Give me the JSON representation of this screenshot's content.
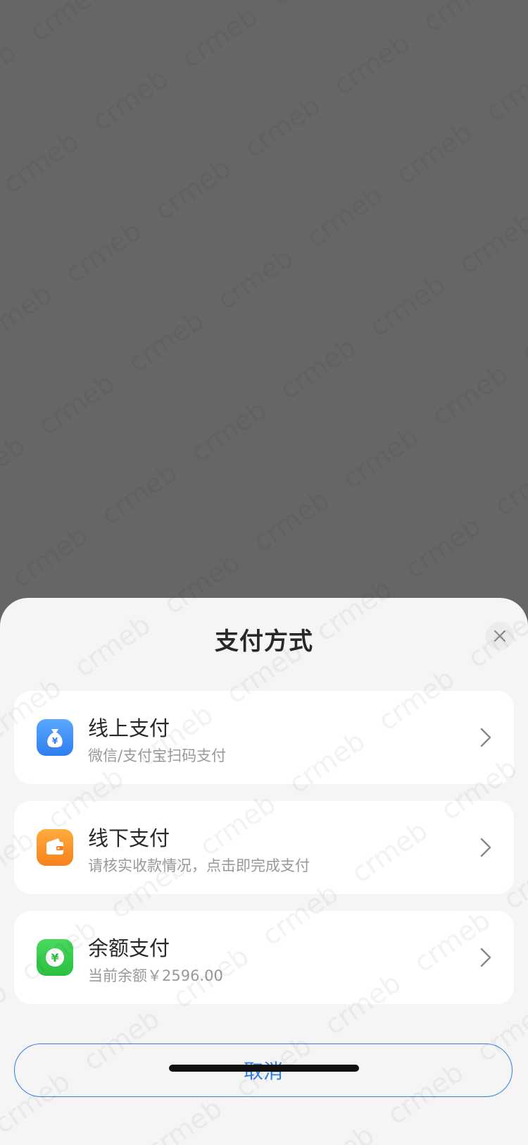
{
  "sheet": {
    "title": "支付方式",
    "close_icon": "close-icon"
  },
  "options": [
    {
      "title": "线上支付",
      "subtitle": "微信/支付宝扫码支付",
      "icon": "money-bag-icon",
      "icon_color": "#3a8df7"
    },
    {
      "title": "线下支付",
      "subtitle": "请核实收款情况，点击即完成支付",
      "icon": "wallet-icon",
      "icon_color": "#fb8c22"
    },
    {
      "title": "余额支付",
      "subtitle": "当前余额￥2596.00",
      "icon": "yuan-coin-icon",
      "icon_color": "#35c84a"
    }
  ],
  "cancel_label": "取消",
  "watermark_text": "crmeb",
  "colors": {
    "overlay": "#666666",
    "sheet_bg": "#f5f5f5",
    "accent": "#2f7fe6"
  }
}
